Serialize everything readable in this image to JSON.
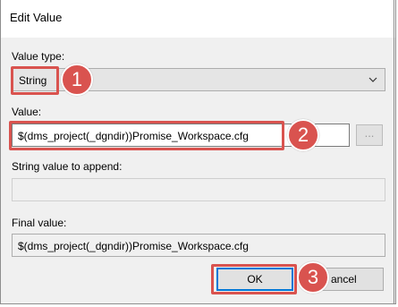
{
  "dialog": {
    "title": "Edit Value",
    "value_type_label": "Value type:",
    "value_type_selected": "String",
    "value_label": "Value:",
    "value_text": "$(dms_project(_dgndir))Promise_Workspace.cfg",
    "browse_label": "...",
    "append_label": "String value to append:",
    "append_value": "",
    "final_label": "Final value:",
    "final_value": "$(dms_project(_dgndir))Promise_Workspace.cfg",
    "ok_label": "OK",
    "cancel_label": "ancel"
  },
  "annotations": {
    "step1": "1",
    "step2": "2",
    "step3": "3",
    "highlight_color": "#d9534f"
  },
  "icons": {
    "dropdown": "chevron-down-icon"
  }
}
